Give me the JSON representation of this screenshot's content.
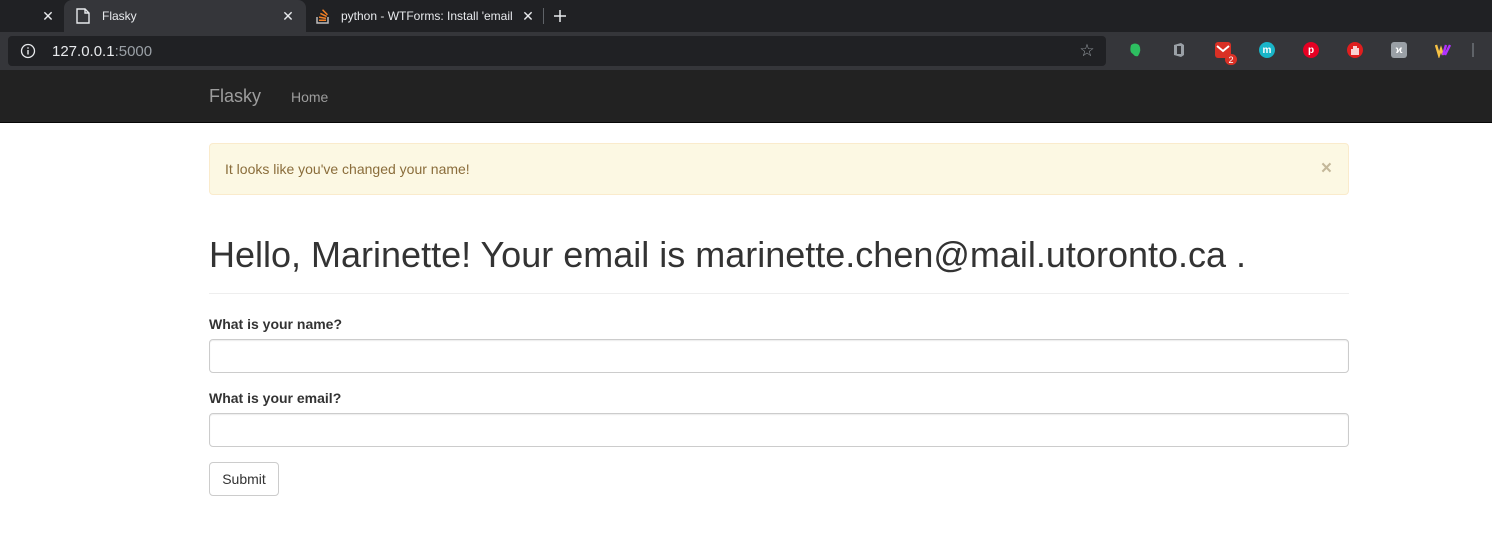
{
  "browser": {
    "tabs": [
      {
        "title": "",
        "active": false
      },
      {
        "title": "Flasky",
        "active": true
      },
      {
        "title": "python - WTForms: Install 'email",
        "active": false
      }
    ],
    "close_glyph": "✕",
    "new_tab_glyph": "+",
    "address": {
      "host": "127.0.0.1",
      "port": ":5000"
    },
    "extensions": [
      {
        "name": "evernote-icon",
        "color": "#2dbe60"
      },
      {
        "name": "office-icon",
        "color": "#9aa0a6"
      },
      {
        "name": "gmail-checker-icon",
        "color": "#d93025",
        "badge": "2"
      },
      {
        "name": "mercury-icon",
        "color": "#19b5c8"
      },
      {
        "name": "pinterest-icon",
        "color": "#e60023"
      },
      {
        "name": "adblock-icon",
        "color": "#e01e1e"
      },
      {
        "name": "pocket-k-icon",
        "color": "#9aa0a6"
      },
      {
        "name": "wappalyzer-icon",
        "color": "#f7c244"
      }
    ]
  },
  "navbar": {
    "brand": "Flasky",
    "links": [
      {
        "label": "Home"
      }
    ]
  },
  "alert": {
    "message": "It looks like you've changed your name!",
    "close": "×"
  },
  "header": {
    "greeting": "Hello, Marinette! Your email is marinette.chen@mail.utoronto.ca ."
  },
  "form": {
    "name_label": "What is your name?",
    "name_value": "",
    "email_label": "What is your email?",
    "email_value": "",
    "submit_label": "Submit"
  },
  "colors": {
    "navbar_bg": "#222222",
    "alert_bg": "#fcf8e3",
    "alert_text": "#8a6d3b"
  }
}
